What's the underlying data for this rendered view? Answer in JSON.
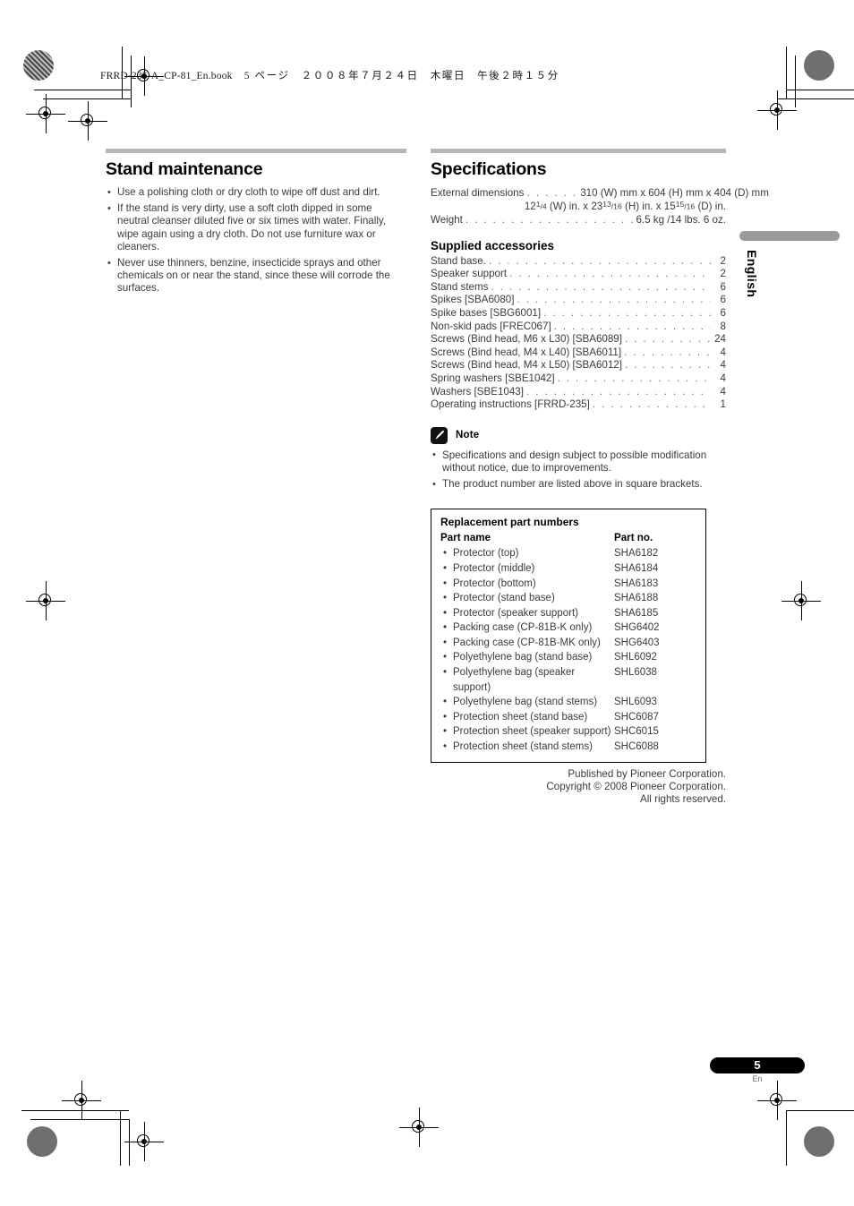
{
  "running_head": {
    "filename": "FRRD-235-A_CP-81_En.book",
    "page_label": "5 ページ",
    "date": "２００８年７月２４日　木曜日　午後２時１５分"
  },
  "stand_maintenance": {
    "title": "Stand maintenance",
    "bullets": [
      "Use a polishing cloth or dry cloth to wipe off dust and dirt.",
      "If the stand is very dirty, use a soft cloth dipped in some neutral cleanser diluted five or six times with water. Finally, wipe again using a dry cloth. Do not use furniture wax or cleaners.",
      "Never use thinners, benzine, insecticide sprays and other chemicals on or near the stand, since these will corrode the surfaces."
    ]
  },
  "specifications": {
    "title": "Specifications",
    "external_dimensions_label": "External dimensions",
    "external_dimensions_leader": ". . . . . .",
    "external_dimensions_mm": "310 (W) mm x 604 (H) mm x 404 (D) mm",
    "external_dimensions_in": {
      "w_whole": "12",
      "w_num": "1",
      "w_den": "4",
      "w_suffix": "(W) in. x",
      "h_whole": "23",
      "h_num": "13",
      "h_den": "16",
      "h_suffix": "(H) in. x",
      "d_whole": "15",
      "d_num": "15",
      "d_den": "16",
      "d_suffix": "(D) in."
    },
    "weight_label": "Weight",
    "weight_leader": ". . . . . . . . . . . . . . . . . . . . . . . . . . . . . . . .",
    "weight_value": "6.5 kg /14 lbs. 6 oz."
  },
  "supplied_accessories": {
    "title": "Supplied accessories",
    "items": [
      {
        "name": "Stand base.",
        "qty": "2"
      },
      {
        "name": "Speaker support",
        "qty": "2"
      },
      {
        "name": "Stand stems",
        "qty": "6"
      },
      {
        "name": "Spikes [SBA6080]",
        "qty": "6"
      },
      {
        "name": "Spike bases [SBG6001]",
        "qty": "6"
      },
      {
        "name": "Non-skid pads [FREC067]",
        "qty": "8"
      },
      {
        "name": "Screws (Bind head, M6 x L30) [SBA6089]",
        "qty": "24"
      },
      {
        "name": "Screws (Bind head, M4 x L40) [SBA6011]",
        "qty": "4"
      },
      {
        "name": "Screws (Bind head, M4 x L50) [SBA6012]",
        "qty": "4"
      },
      {
        "name": "Spring washers [SBE1042]",
        "qty": "4"
      },
      {
        "name": "Washers [SBE1043]",
        "qty": "4"
      },
      {
        "name": "Operating instructions [FRRD-235]",
        "qty": "1"
      }
    ]
  },
  "note": {
    "icon": "pencil-icon",
    "label": "Note",
    "bullets": [
      "Specifications and design subject to possible modification without notice, due to improvements.",
      "The product number are listed above in square brackets."
    ]
  },
  "replacement_parts": {
    "title": "Replacement part numbers",
    "columns": [
      "Part name",
      "Part no."
    ],
    "rows": [
      {
        "name": "Protector (top)",
        "no": "SHA6182"
      },
      {
        "name": "Protector (middle)",
        "no": "SHA6184"
      },
      {
        "name": "Protector (bottom)",
        "no": "SHA6183"
      },
      {
        "name": "Protector (stand base)",
        "no": "SHA6188"
      },
      {
        "name": "Protector (speaker support)",
        "no": "SHA6185"
      },
      {
        "name": "Packing case (CP-81B-K only)",
        "no": "SHG6402"
      },
      {
        "name": "Packing case (CP-81B-MK only)",
        "no": "SHG6403"
      },
      {
        "name": "Polyethylene bag (stand base)",
        "no": "SHL6092"
      },
      {
        "name": "Polyethylene bag (speaker support)",
        "no": "SHL6038"
      },
      {
        "name": "Polyethylene bag (stand stems)",
        "no": "SHL6093"
      },
      {
        "name": "Protection sheet (stand base)",
        "no": "SHC6087"
      },
      {
        "name": "Protection sheet (speaker support)",
        "no": "SHC6015"
      },
      {
        "name": "Protection sheet (stand stems)",
        "no": "SHC6088"
      }
    ]
  },
  "publisher": {
    "line1": "Published by Pioneer Corporation.",
    "line2": "Copyright © 2008 Pioneer Corporation.",
    "line3": "All rights reserved."
  },
  "side_tab": {
    "language": "English"
  },
  "page_number": {
    "number": "5",
    "suffix": "En"
  },
  "colors": {
    "rule_gray": "#b6b6b6",
    "body_gray": "#3b3b3b",
    "tab_gray": "#9a9a9a",
    "badge_black": "#000000"
  }
}
